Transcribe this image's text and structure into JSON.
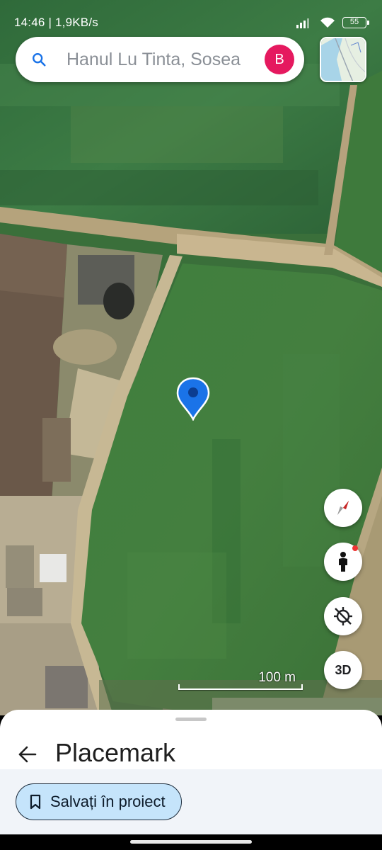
{
  "status_bar": {
    "time": "14:46 | 1,9KB/s",
    "battery": "55",
    "icons": [
      "signal-icon",
      "wifi-icon",
      "battery-icon"
    ]
  },
  "search": {
    "query": "Hanul Lu Tinta, Sosea",
    "avatar_letter": "B",
    "avatar_color": "#e5195f"
  },
  "map": {
    "type": "satellite",
    "scale_label": "100 m",
    "placemark_color": "#1a73e8"
  },
  "controls": {
    "compass": "compass-icon",
    "street_view": "pegman-icon",
    "my_location": "location-off-icon",
    "view_3d_label": "3D"
  },
  "sheet": {
    "title": "Placemark",
    "save_button_label": "Salvați în proiect"
  }
}
